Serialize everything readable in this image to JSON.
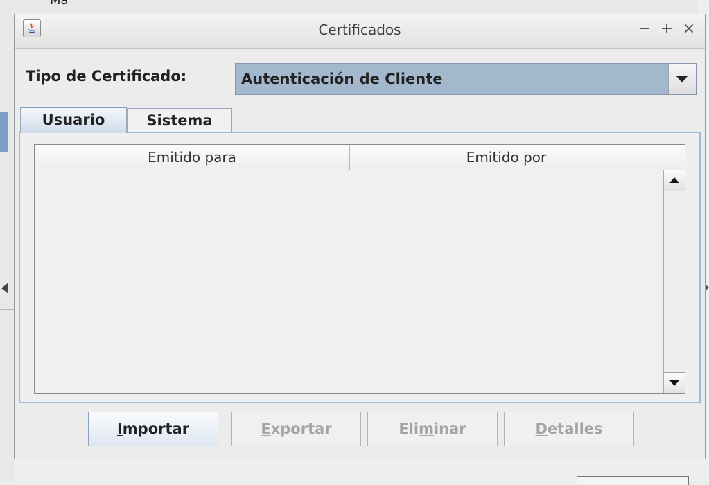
{
  "background": {
    "text": "Ma"
  },
  "dialog": {
    "title": "Certificados",
    "controls": {
      "minimize": "−",
      "maximize": "+",
      "close": "×"
    }
  },
  "certificate_type": {
    "label": "Tipo de Certificado:",
    "selected": "Autenticación de Cliente"
  },
  "tabs": [
    {
      "label": "Usuario",
      "selected": true
    },
    {
      "label": "Sistema",
      "selected": false
    }
  ],
  "table": {
    "columns": [
      "Emitido para",
      "Emitido por"
    ],
    "rows": []
  },
  "buttons": {
    "importar": {
      "mnemonic": "I",
      "rest": "mportar",
      "enabled": true
    },
    "exportar": {
      "mnemonic": "E",
      "rest": "xportar",
      "enabled": false
    },
    "eliminar": {
      "before": "Eli",
      "mnemonic": "m",
      "after": "inar",
      "enabled": false
    },
    "detalles": {
      "mnemonic": "D",
      "rest": "etalles",
      "enabled": false
    }
  }
}
